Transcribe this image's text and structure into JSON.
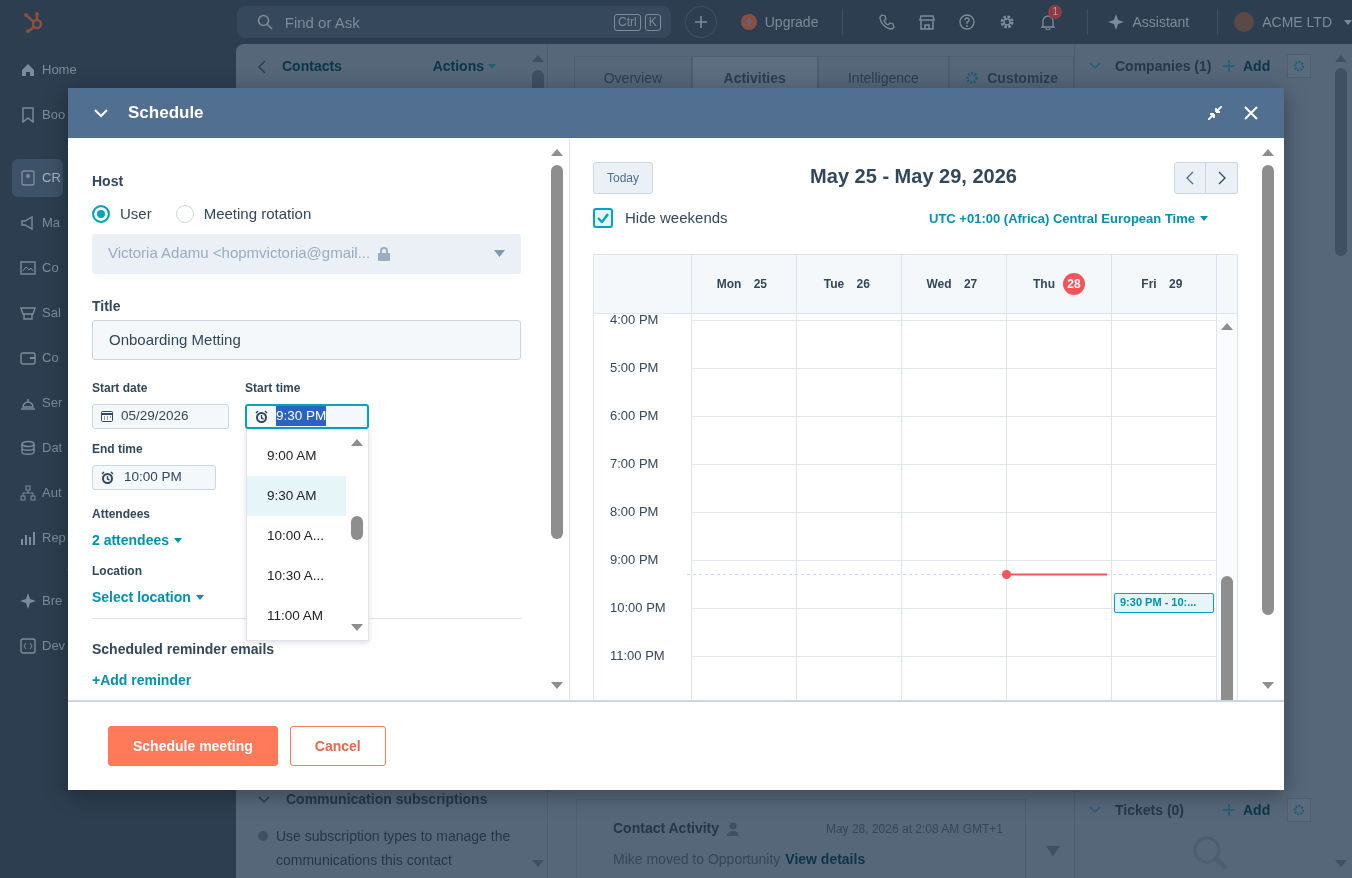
{
  "topbar": {
    "search": {
      "placeholder": "Find or Ask",
      "shortcut": [
        "Ctrl",
        "K"
      ]
    },
    "upgrade": "Upgrade",
    "notifications": "1",
    "assistant": "Assistant",
    "account": "ACME LTD"
  },
  "sidebar": {
    "groups": [
      {
        "items": [
          {
            "label": "Home",
            "selected": false
          },
          {
            "label": "Boo",
            "selected": false
          }
        ]
      },
      {
        "items": [
          {
            "label": "CR",
            "selected": true
          },
          {
            "label": "Ma",
            "selected": false
          },
          {
            "label": "Co",
            "selected": false
          },
          {
            "label": "Sal",
            "selected": false
          },
          {
            "label": "Co",
            "selected": false
          },
          {
            "label": "Ser",
            "selected": false
          },
          {
            "label": "Dat",
            "selected": false
          },
          {
            "label": "Aut",
            "selected": false
          },
          {
            "label": "Rep",
            "selected": false
          }
        ]
      },
      {
        "items": [
          {
            "label": "Bre",
            "selected": false
          },
          {
            "label": "Dev",
            "selected": false
          }
        ]
      }
    ]
  },
  "record": {
    "back_link": "Contacts",
    "actions": "Actions",
    "section": {
      "title": "Communication subscriptions",
      "note": "Use subscription types to manage the communications this contact"
    }
  },
  "tabs": [
    {
      "label": "Overview",
      "selected": false
    },
    {
      "label": "Activities",
      "selected": true
    },
    {
      "label": "Intelligence",
      "selected": false
    }
  ],
  "customize": "Customize",
  "activity": {
    "title": "Contact Activity",
    "time": "May 28, 2026 at 2:08 AM GMT+1",
    "text": "Mike moved to Opportunity",
    "link": "View details"
  },
  "side_cards": [
    {
      "title": "Companies (1)",
      "add": "Add"
    },
    {
      "title": "Tickets (0)",
      "add": "Add"
    }
  ],
  "modal": {
    "title": "Schedule",
    "host": {
      "label": "Host",
      "options": [
        {
          "label": "User",
          "selected": true
        },
        {
          "label": "Meeting rotation",
          "selected": false
        }
      ],
      "value": "Victoria Adamu <hopmvictoria@gmail...",
      "disabled": true
    },
    "title_field": {
      "label": "Title",
      "value": "Onboarding Metting"
    },
    "start_date": {
      "label": "Start date",
      "value": "05/29/2026"
    },
    "start_time": {
      "label": "Start time",
      "value": "9:30 PM"
    },
    "end_time": {
      "label": "End time",
      "value": "10:00 PM"
    },
    "attendees": {
      "label": "Attendees",
      "link": "2 attendees"
    },
    "location": {
      "label": "Location",
      "link": "Select location"
    },
    "reminders": {
      "label": "Scheduled reminder emails",
      "link": "+Add reminder"
    },
    "time_options": [
      {
        "label": "9:00 AM",
        "selected": false
      },
      {
        "label": "9:30 AM",
        "selected": true
      },
      {
        "label": "10:00 A...",
        "selected": false
      },
      {
        "label": "10:30 A...",
        "selected": false
      },
      {
        "label": "11:00 AM",
        "selected": false
      }
    ],
    "calendar": {
      "today_button": "Today",
      "range": "May 25 - May 29, 2026",
      "hide_weekends": {
        "label": "Hide weekends",
        "checked": true
      },
      "timezone": "UTC +01:00 (Africa) Central European Time",
      "days": [
        {
          "name": "Mon",
          "date": "25",
          "today": false
        },
        {
          "name": "Tue",
          "date": "26",
          "today": false
        },
        {
          "name": "Wed",
          "date": "27",
          "today": false
        },
        {
          "name": "Thu",
          "date": "28",
          "today": true
        },
        {
          "name": "Fri",
          "date": "29",
          "today": false,
          "events": [
            {
              "label": "9:30 PM - 10:..."
            }
          ]
        }
      ],
      "hours": [
        "4:00 PM",
        "5:00 PM",
        "6:00 PM",
        "7:00 PM",
        "8:00 PM",
        "9:00 PM",
        "10:00 PM",
        "11:00 PM"
      ]
    },
    "buttons": [
      {
        "label": "Schedule meeting",
        "kind": "primary"
      },
      {
        "label": "Cancel",
        "kind": "secondary"
      }
    ]
  }
}
